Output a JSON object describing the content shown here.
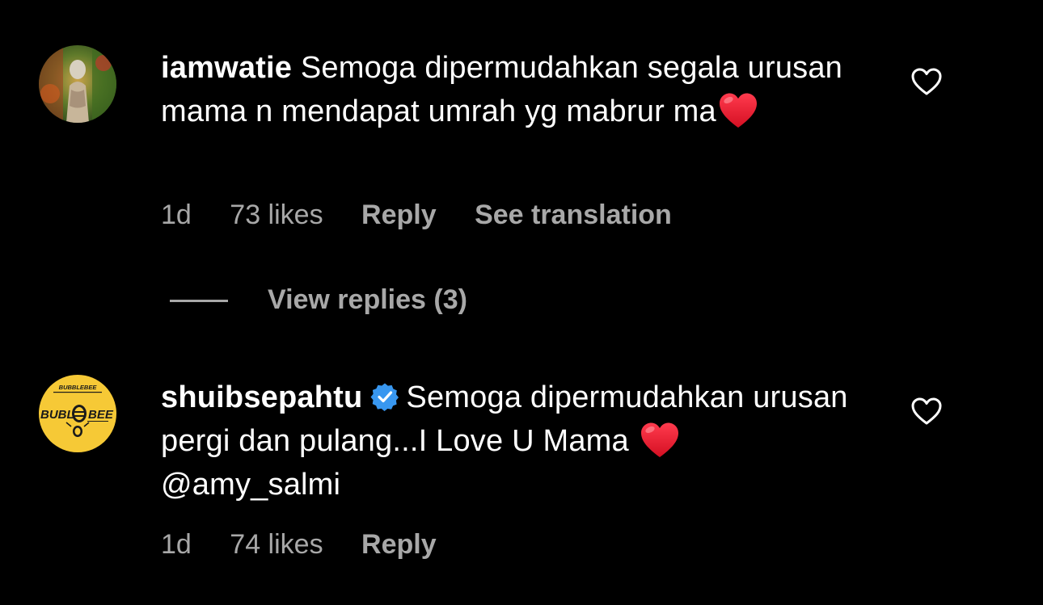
{
  "comments": [
    {
      "username": "iamwatie",
      "text": "Semoga dipermudahkan segala urusan mama n mendapat umrah yg mabrur ma",
      "time": "1d",
      "likes": "73 likes",
      "reply_label": "Reply",
      "translate_label": "See translation",
      "emoji": "red-heart",
      "verified": false
    },
    {
      "username": "shuibsepahtu",
      "text": "Semoga dipermudahkan urusan pergi dan pulang...I Love U Mama ",
      "mention": "@amy_salmi",
      "time": "1d",
      "likes": "74 likes",
      "reply_label": "Reply",
      "emoji": "red-heart",
      "verified": true,
      "avatar_text_top": "BUBBLEBEE",
      "avatar_text_main_left": "BUBL",
      "avatar_text_main_right": "BEE"
    }
  ],
  "view_replies": {
    "label": "View replies (3)"
  },
  "colors": {
    "background": "#000000",
    "text": "#ffffff",
    "muted": "#a8a8a8",
    "verified": "#3897f0",
    "heart": "#e0142b",
    "avatar2_bg": "#f6c936"
  }
}
